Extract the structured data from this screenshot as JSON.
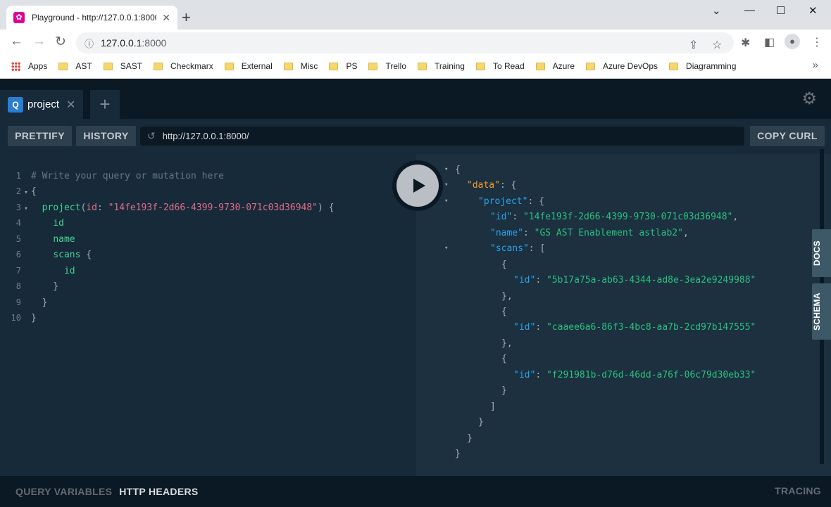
{
  "browser": {
    "tab_title": "Playground - http://127.0.0.1:8000/",
    "url_host": "127.0.0.1",
    "url_port": ":8000",
    "bookmarks": [
      "Apps",
      "AST",
      "SAST",
      "Checkmarx",
      "External",
      "Misc",
      "PS",
      "Trello",
      "Training",
      "To Read",
      "Azure",
      "Azure DevOps",
      "Diagramming"
    ]
  },
  "playground": {
    "tab_label": "project",
    "tab_badge": "Q",
    "prettify": "PRETTIFY",
    "history": "HISTORY",
    "endpoint": "http://127.0.0.1:8000/",
    "copy_curl": "COPY CURL",
    "docs": "DOCS",
    "schema": "SCHEMA",
    "query_variables": "QUERY VARIABLES",
    "http_headers": "HTTP HEADERS",
    "tracing": "TRACING"
  },
  "query": {
    "comment": "# Write your query or mutation here",
    "root_field": "project",
    "arg_name": "id",
    "arg_value": "\"14fe193f-2d66-4399-9730-071c03d36948\"",
    "fields": [
      "id",
      "name",
      "scans"
    ],
    "scan_fields": [
      "id"
    ]
  },
  "result": {
    "data_key": "\"data\"",
    "project_key": "\"project\"",
    "id_key": "\"id\"",
    "name_key": "\"name\"",
    "scans_key": "\"scans\"",
    "project_id": "\"14fe193f-2d66-4399-9730-071c03d36948\"",
    "project_name": "\"GS AST Enablement astlab2\"",
    "scan_ids": [
      "\"5b17a75a-ab63-4344-ad8e-3ea2e9249988\"",
      "\"caaee6a6-86f3-4bc8-aa7b-2cd97b147555\"",
      "\"f291981b-d76d-46dd-a76f-06c79d30eb33\""
    ]
  }
}
